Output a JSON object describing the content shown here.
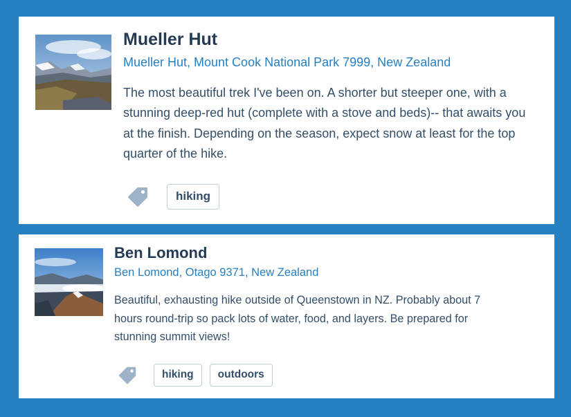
{
  "cards": [
    {
      "title": "Mueller Hut",
      "address": "Mueller Hut, Mount Cook National Park 7999, New Zealand",
      "description": "The most beautiful trek I've been on. A shorter but steeper one, with a stunning deep-red hut (complete with a stove and beds)-- that awaits you at the finish. Depending on the season, expect snow at least for the top quarter of the hike.",
      "tag_icon": "tag-icon",
      "tags": [
        "hiking"
      ]
    },
    {
      "title": "Ben Lomond",
      "address": "Ben Lomond, Otago 9371, New Zealand",
      "description": "Beautiful, exhausting hike outside of Queenstown in NZ. Probably about 7 hours round-trip so pack lots of water, food, and layers. Be prepared for stunning summit views!",
      "tag_icon": "tag-icon",
      "tags": [
        "hiking",
        "outdoors"
      ]
    }
  ],
  "colors": {
    "page_background": "#2680c2",
    "title": "#243b53",
    "link": "#2680c2",
    "body_text": "#334e68",
    "tag_border": "#bcccdc",
    "tag_icon": "#9fb3c8"
  }
}
